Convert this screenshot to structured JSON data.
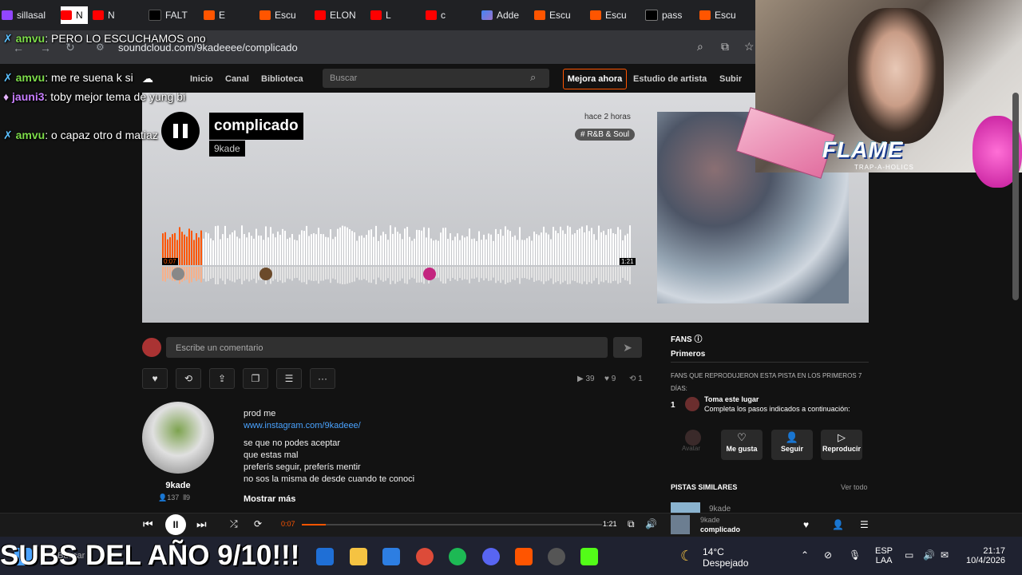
{
  "browser": {
    "tabs": [
      {
        "label": "sillasal",
        "icon": "twitch-icon"
      },
      {
        "label": "N",
        "icon": "youtube-icon"
      },
      {
        "label": "FALT",
        "icon": "tiktok-icon"
      },
      {
        "label": "E",
        "icon": "soundcloud-icon"
      },
      {
        "label": "Escu",
        "icon": "soundcloud-icon"
      },
      {
        "label": "ELON",
        "icon": "youtube-icon"
      },
      {
        "label": "L",
        "icon": "youtube-icon"
      },
      {
        "label": "c",
        "icon": "youtube-icon"
      },
      {
        "label": "Adde",
        "icon": "gemini-icon"
      },
      {
        "label": "Escu",
        "icon": "soundcloud-icon"
      },
      {
        "label": "Escu",
        "icon": "soundcloud-icon"
      },
      {
        "label": "pass",
        "icon": "x-icon"
      },
      {
        "label": "Escu",
        "icon": "soundcloud-icon"
      }
    ],
    "url": "soundcloud.com/9kadeeee/complicado"
  },
  "sc_nav": {
    "home": "Inicio",
    "feed": "Canal",
    "library": "Biblioteca",
    "search_placeholder": "Buscar",
    "upgrade": "Mejora ahora",
    "artist_studio": "Estudio de artista",
    "upload": "Subir"
  },
  "track": {
    "title": "complicado",
    "artist": "9kade",
    "posted": "hace 2 horas",
    "genre": "# R&B & Soul",
    "current_time": "0:07",
    "duration": "1:21",
    "progress_fraction": 0.086,
    "plays": "39",
    "likes": "9",
    "reposts": "1"
  },
  "comment": {
    "placeholder": "Escribe un comentario"
  },
  "uploader": {
    "name": "9kade",
    "followers": "137",
    "tracks": "9"
  },
  "description": {
    "line1": "prod me",
    "link": "www.instagram.com/9kadeee/",
    "lyrics": [
      "se que no podes aceptar",
      "que estas mal",
      "preferís seguir, preferís mentir",
      "no sos la misma de desde cuando te conoci"
    ],
    "show_more": "Mostrar más"
  },
  "fans_panel": {
    "title": "FANS",
    "tab": "Primeros",
    "subtitle": "FANS QUE REPRODUJERON ESTA PISTA EN LOS PRIMEROS 7 DÍAS:",
    "rank": "1",
    "claim_title": "Toma este lugar",
    "claim_desc": "Completa los pasos indicados a continuación:",
    "avatar_label": "Avatar",
    "like_label": "Me gusta",
    "follow_label": "Seguir",
    "play_label": "Reproducir"
  },
  "similar": {
    "title": "PISTAS SIMILARES",
    "see_all": "Ver todo",
    "first_artist": "9kade"
  },
  "player": {
    "current": "0:07",
    "total": "1:21",
    "artist": "9kade",
    "title": "complicado"
  },
  "chat": [
    {
      "user": "amvu",
      "color": "#7ddc4a",
      "text": "PERO LO ESCUCHAMOS ono"
    },
    {
      "user": "amvu",
      "color": "#7ddc4a",
      "text": "me re suena k si"
    },
    {
      "user": "jauni3",
      "color": "#c77dff",
      "text": "toby mejor tema de yung bi"
    },
    {
      "user": "amvu",
      "color": "#7ddc4a",
      "text": "o capaz otro d matiaz"
    }
  ],
  "overlay": {
    "brand": "FLAME",
    "brand_sub": "TRAP-A-HOLICS",
    "subs_text": "SUBS DEL AÑO 9/10!!!"
  },
  "taskbar": {
    "search_placeholder": "Buscar",
    "weather_temp": "14°C",
    "weather_desc": "Despejado",
    "lang1": "ESP",
    "lang2": "LAA",
    "time": "21:17",
    "date": "10/4/2026"
  },
  "colors": {
    "accent": "#ff5500",
    "chat_user": "#7ddc4a"
  }
}
